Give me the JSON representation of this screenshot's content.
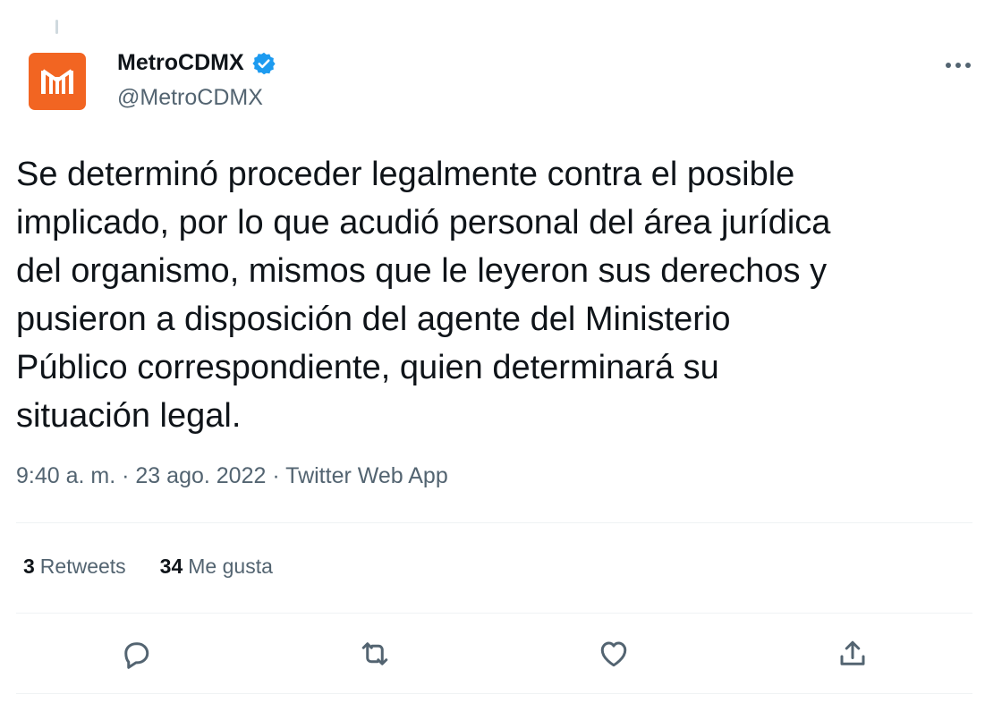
{
  "author": {
    "display_name": "MetroCDMX",
    "handle": "@MetroCDMX",
    "avatar_icon": "metro-logo-icon",
    "avatar_color": "#f26522",
    "verified": true,
    "verified_color": "#1d9bf0"
  },
  "tweet": {
    "text": "Se determinó proceder legalmente contra el posible\nimplicado, por lo que acudió personal del área jurídica\ndel organismo, mismos que le leyeron sus derechos y\npusieron a disposición del agente del Ministerio\nPúblico correspondiente, quien determinará su\nsituación legal.",
    "time": "9:40 a. m.",
    "date": "23 ago. 2022",
    "source": "Twitter Web App",
    "separator": "·"
  },
  "stats": {
    "retweets_count": "3",
    "retweets_label": "Retweets",
    "likes_count": "34",
    "likes_label": "Me gusta"
  },
  "actions": [
    "reply-icon",
    "retweet-icon",
    "like-icon",
    "share-icon"
  ],
  "colors": {
    "text": "#0f1419",
    "secondary": "#536471",
    "divider": "#eff3f4"
  }
}
